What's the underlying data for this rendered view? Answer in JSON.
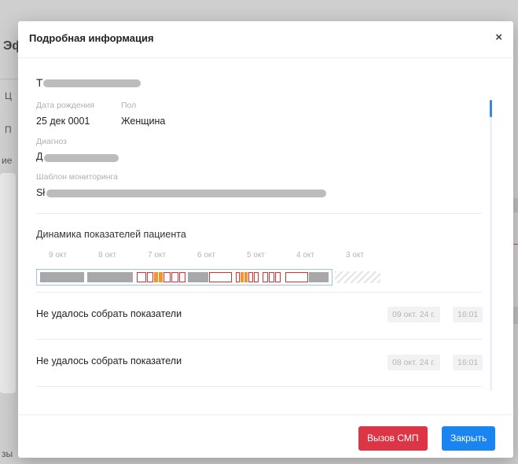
{
  "background": {
    "fragments": [
      "Эф",
      "Ц",
      "П",
      "ие",
      "зы"
    ]
  },
  "modal": {
    "title": "Подробная информация",
    "close_glyph": "×",
    "patient": {
      "name_initial": "Т",
      "birth_label": "Дата рождения",
      "birth_value": "25 дек 0001",
      "gender_label": "Пол",
      "gender_value": "Женщина",
      "diagnosis_label": "Диагноз",
      "diagnosis_initial": "Д",
      "template_label": "Шаблон мониторинга",
      "template_initial": "Sł"
    },
    "dynamics": {
      "title": "Динамика показателей пациента",
      "days": [
        "9 окт",
        "8 окт",
        "7 окт",
        "6 окт",
        "5 окт",
        "4 окт",
        "3 окт"
      ]
    },
    "events": [
      {
        "text": "Не удалось собрать показатели",
        "date": "09 окт. 24 г.",
        "time": "16:01"
      },
      {
        "text": "Не удалось собрать показатели",
        "date": "08 окт. 24 г.",
        "time": "16:01"
      }
    ],
    "buttons": {
      "call_ambulance": "Вызов СМП",
      "close": "Закрыть"
    }
  },
  "colors": {
    "danger": "#dc3545",
    "primary": "#1a84f0",
    "alert_outline": "#e03030",
    "partial_fill": "#f0952f"
  }
}
